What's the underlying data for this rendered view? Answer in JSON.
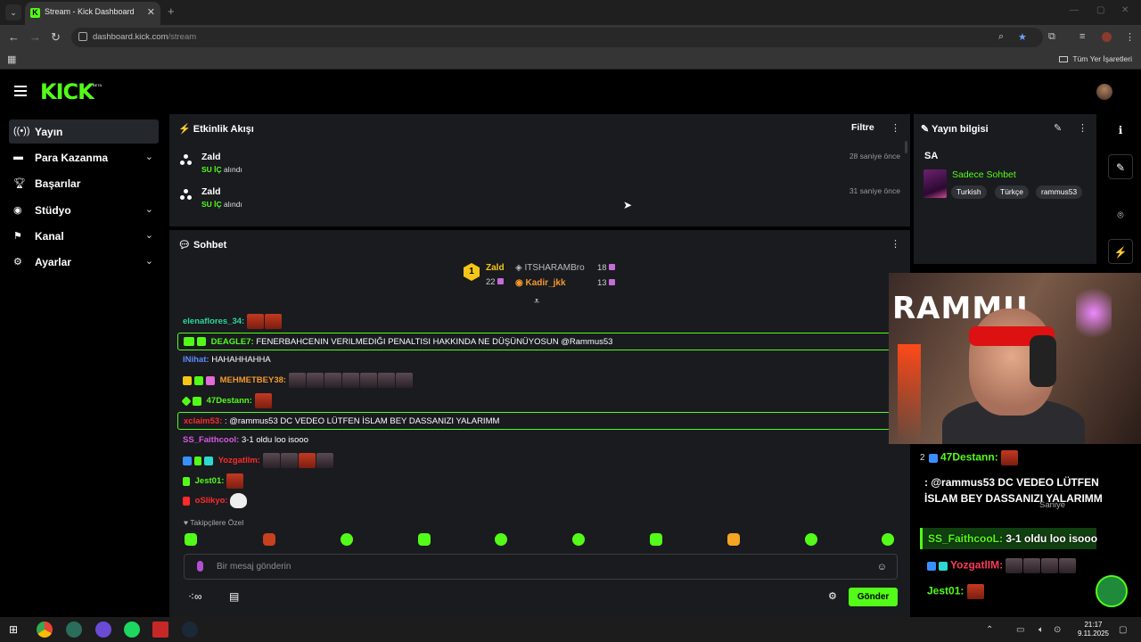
{
  "browser": {
    "tab_title": "Stream - Kick Dashboard",
    "url_host": "dashboard.kick.com",
    "url_path": "/stream",
    "bookmarks_all": "Tüm Yer İşaretleri"
  },
  "brand": {
    "logo": "KICK",
    "beta": "BETA",
    "accent": "#53fc18"
  },
  "sidebar": {
    "items": [
      {
        "label": "Yayın",
        "icon": "broadcast-icon"
      },
      {
        "label": "Para Kazanma",
        "icon": "money-icon"
      },
      {
        "label": "Başarılar",
        "icon": "trophy-icon"
      },
      {
        "label": "Stüdyo",
        "icon": "studio-icon"
      },
      {
        "label": "Kanal",
        "icon": "channel-icon"
      },
      {
        "label": "Ayarlar",
        "icon": "settings-icon"
      }
    ]
  },
  "activity": {
    "title": "Etkinlik Akışı",
    "filter": "Filtre",
    "events": [
      {
        "user": "Zald",
        "item": "SU İÇ",
        "action": "alındı",
        "time": "28 saniye önce"
      },
      {
        "user": "Zald",
        "item": "SU İÇ",
        "action": "alındı",
        "time": "31 saniye önce"
      }
    ]
  },
  "chat": {
    "title": "Sohbet",
    "leaderboard": [
      {
        "rank": "1",
        "name": "Zald",
        "count": "22"
      },
      {
        "name": "ITSHARAMBro",
        "count": "18"
      },
      {
        "name": "Kadir_jkk",
        "count": "13"
      }
    ],
    "messages": [
      {
        "user": "elenaflores_34:",
        "text": ""
      },
      {
        "user": "DEAGLE7:",
        "text": "FENERBAHCENIN VERILMEDIĞI PENALTISI HAKKINDA NE DÜŞÜNÜYOSUN @Rammus53"
      },
      {
        "user": "lNihat:",
        "text": "HAHAHHAHHA"
      },
      {
        "user": "MEHMETBEY38:",
        "text": ""
      },
      {
        "user": "47Destann:",
        "text": ""
      },
      {
        "user": "xclaim53:",
        "text": ": @rammus53 DC VEDEO LÜTFEN İSLAM BEY DASSANIZI YALARIMM"
      },
      {
        "user": "SS_Faithcool:",
        "text": "3-1 oldu loo isooo"
      },
      {
        "user": "Yozgatllm:",
        "text": ""
      },
      {
        "user": "Jest01:",
        "text": ""
      },
      {
        "user": "oSlikyo:",
        "text": ""
      }
    ],
    "followers_only": "Takipçilere Özel",
    "placeholder": "Bir mesaj gönderin",
    "send": "Gönder"
  },
  "stream_info": {
    "title": "Yayın bilgisi",
    "stream_title": "SA",
    "category": "Sadece Sohbet",
    "tags": [
      "Turkish",
      "Türkçe",
      "rammus53"
    ]
  },
  "overlay": {
    "cam_text": "RAMMU",
    "rows": [
      {
        "user": "47Destann:"
      },
      {
        "user": "SS_FaithcooL:",
        "text": "3-1 oldu loo isooo"
      },
      {
        "user": "YozgatlIM:"
      },
      {
        "user": "Jest01:"
      }
    ],
    "message": ": @rammus53 DC VEDEO LÜTFEN İSLAM BEY DASSANIZI YALARIMM",
    "ghost_num": "2",
    "ghost_unit": "Saniye"
  },
  "taskbar": {
    "time": "21:17",
    "date": "9.11.2025"
  }
}
